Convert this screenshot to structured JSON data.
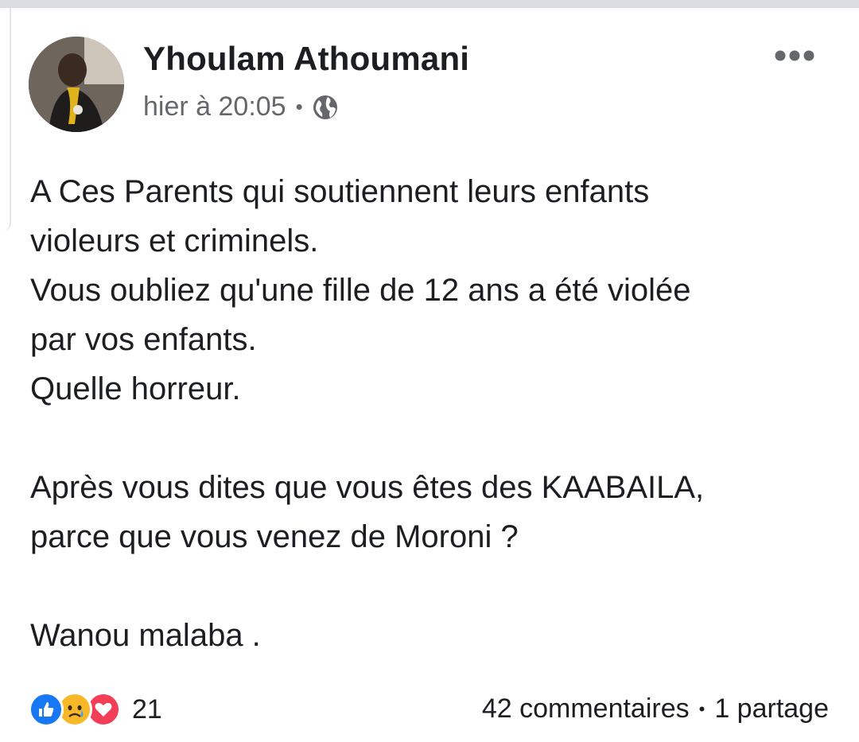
{
  "post": {
    "author": "Yhoulam Athoumani",
    "timestamp": "hier à 20:05",
    "separator": "•",
    "privacy_icon": "globe-icon",
    "more_icon": "more-horizontal-icon",
    "lines": [
      "A Ces Parents qui soutiennent leurs enfants",
      "violeurs et criminels.",
      "Vous oubliez qu'une fille de 12 ans a été violée",
      "par vos enfants.",
      "Quelle horreur.",
      "",
      "Après vous dites que vous êtes des KAABAILA,",
      "parce que vous venez de Moroni ?",
      "",
      "Wanou malaba ."
    ]
  },
  "footer": {
    "reaction_icons": [
      "like-icon",
      "sad-icon",
      "love-icon"
    ],
    "reaction_count": "21",
    "comments": "42 commentaires",
    "separator": "•",
    "shares": "1 partage"
  },
  "colors": {
    "like": "#1877f2",
    "sad": "#f7b928",
    "love": "#f33e58",
    "text": "#1c1e21",
    "secondary_text": "#65676b"
  }
}
